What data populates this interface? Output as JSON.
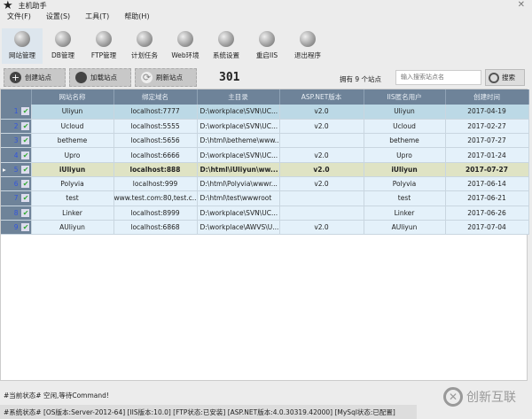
{
  "window": {
    "title": "主机助手",
    "close": "✕"
  },
  "menu": [
    "文件(F)",
    "设置(S)",
    "工具(T)",
    "帮助(H)"
  ],
  "toolbar": [
    "网站管理",
    "DB管理",
    "FTP管理",
    "计划任务",
    "Web环境",
    "系统设置",
    "重启IIS",
    "退出程序"
  ],
  "actions": {
    "create": "创建站点",
    "load": "加载站点",
    "refresh": "刷新站点",
    "code": "301",
    "count": "拥有 9 个站点",
    "search_placeholder": "输入搜索站点名",
    "search": "搜索"
  },
  "table": {
    "columns": [
      "网站名称",
      "绑定域名",
      "主目录",
      "ASP.NET版本",
      "IIS匿名用户",
      "创建时间"
    ],
    "selected_row": 5,
    "rows": [
      [
        "1",
        "Uliyun",
        "localhost:7777",
        "D:\\workplace\\SVN\\UC...",
        "v2.0",
        "Uliyun",
        "2017-04-19"
      ],
      [
        "2",
        "Ucloud",
        "localhost:5555",
        "D:\\workplace\\SVN\\UC...",
        "v2.0",
        "Ucloud",
        "2017-02-27"
      ],
      [
        "3",
        "betheme",
        "localhost:5656",
        "D:\\html\\betheme\\www...",
        "",
        "betheme",
        "2017-07-27"
      ],
      [
        "4",
        "Upro",
        "localhost:6666",
        "D:\\workplace\\SVN\\UC...",
        "v2.0",
        "Upro",
        "2017-01-24"
      ],
      [
        "5",
        "iUliyun",
        "localhost:888",
        "D:\\html\\iUliyun\\ww...",
        "v2.0",
        "iUliyun",
        "2017-07-27"
      ],
      [
        "6",
        "Polyvia",
        "localhost:999",
        "D:\\html\\Polyvia\\wwwr...",
        "v2.0",
        "Polyvia",
        "2017-06-14"
      ],
      [
        "7",
        "test",
        "www.test.com:80,test.c...",
        "D:\\html\\test\\wwwroot",
        "",
        "test",
        "2017-06-21"
      ],
      [
        "8",
        "Linker",
        "localhost:8999",
        "D:\\workplace\\SVN\\UC...",
        "",
        "Linker",
        "2017-06-26"
      ],
      [
        "9",
        "AUliyun",
        "localhost:6868",
        "D:\\workplace\\AWVS\\U...",
        "v2.0",
        "AUliyun",
        "2017-07-04"
      ]
    ]
  },
  "status": {
    "current": "#当前状态#  空闲,等待Command!",
    "system": "#系统状态#  [OS版本:Server-2012-64] [IIS版本:10.0] [FTP状态:已安装] [ASP.NET版本:4.0.30319.42000] [MySql状态:已配置]"
  },
  "watermark": {
    "text": "创新互联"
  }
}
